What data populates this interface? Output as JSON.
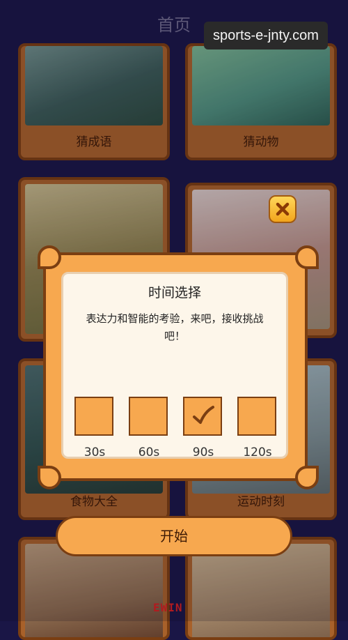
{
  "header": {
    "title": "首页"
  },
  "watermark": {
    "text": "sports-e-jnty.com"
  },
  "categories": [
    {
      "label": "猜成语"
    },
    {
      "label": "猜动物"
    },
    {
      "label": ""
    },
    {
      "label": ""
    },
    {
      "label": "食物大全"
    },
    {
      "label": "运动时刻"
    },
    {
      "label": ""
    },
    {
      "label": ""
    }
  ],
  "modal": {
    "title": "时间选择",
    "description": "表达力和智能的考验，来吧，接收挑战吧！",
    "options": [
      {
        "label": "30s",
        "checked": false
      },
      {
        "label": "60s",
        "checked": false
      },
      {
        "label": "90s",
        "checked": true
      },
      {
        "label": "120s",
        "checked": false
      }
    ],
    "close_icon": "close-icon",
    "start_label": "开始"
  },
  "footer_logo": {
    "text": "EWIN"
  },
  "colors": {
    "background": "#1a1646",
    "accent": "#f7a84f",
    "border": "#7a3e12"
  }
}
